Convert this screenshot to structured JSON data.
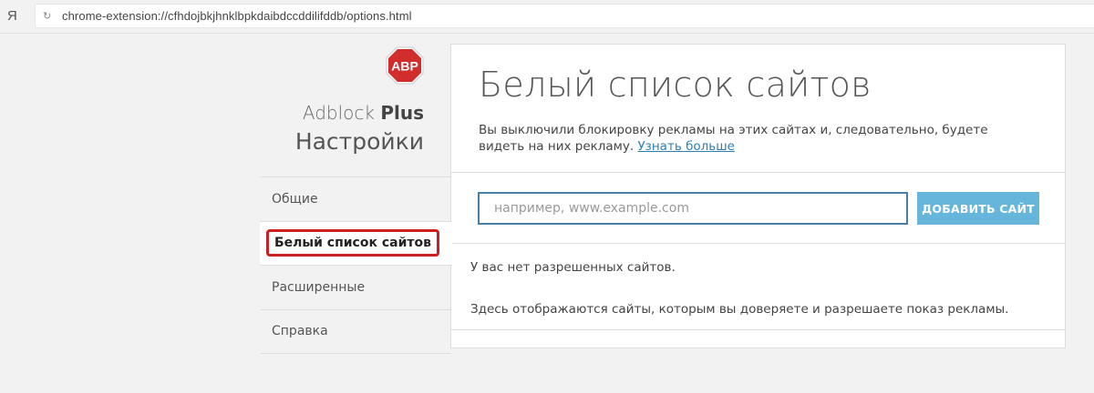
{
  "browser": {
    "logo_text": "Я",
    "reload_icon": "reload-icon",
    "url": "chrome-extension://cfhdojbkjhnklbpkdaibdccddilifddb/options.html"
  },
  "sidebar": {
    "logo_text": "ABP",
    "brand_light": "Adblock ",
    "brand_bold": "Plus",
    "settings_title": "Настройки",
    "items": [
      {
        "label": "Общие",
        "active": false
      },
      {
        "label": "Белый список сайтов",
        "active": true
      },
      {
        "label": "Расширенные",
        "active": false
      },
      {
        "label": "Справка",
        "active": false
      }
    ]
  },
  "main": {
    "title": "Белый список сайтов",
    "description": "Вы выключили блокировку рекламы на этих сайтах и, следовательно, будете видеть на них рекламу. ",
    "learn_more_link": "Узнать больше",
    "input_value": "",
    "input_placeholder": "например, www.example.com",
    "add_button_label": "ДОБАВИТЬ САЙТ",
    "empty_message": "У вас нет разрешенных сайтов.",
    "hint_message": "Здесь отображаются сайты, которым вы доверяете и разрешаете показ рекламы."
  },
  "colors": {
    "abp_red": "#d22d2d",
    "highlight_frame": "#cc1f1f",
    "button_blue": "#66b6dc",
    "input_border": "#4a7fa5",
    "link": "#2c7fb8"
  }
}
